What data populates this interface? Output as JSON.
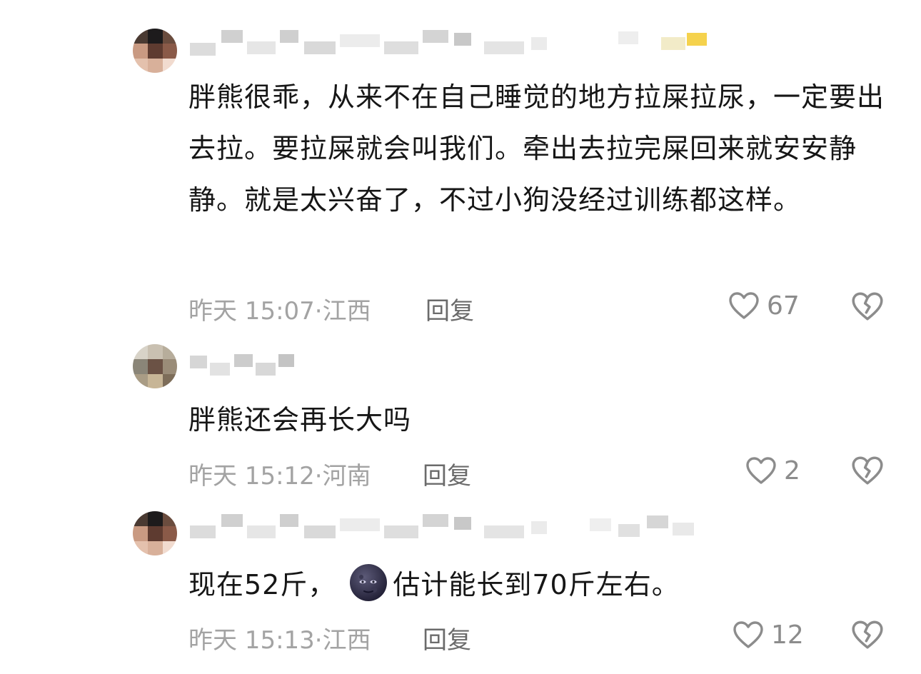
{
  "comments": [
    {
      "text": "胖熊很乖，从来不在自己睡觉的地方拉屎拉尿，一定要出去拉。要拉屎就会叫我们。牵出去拉完屎回来就安安静静。就是太兴奋了，不过小狗没经过训练都这样。",
      "time": "昨天 15:07",
      "location": "江西",
      "reply_label": "回复",
      "likes": "67"
    },
    {
      "text": "胖熊还会再长大吗",
      "time": "昨天 15:12",
      "location": "河南",
      "reply_label": "回复",
      "likes": "2"
    },
    {
      "text_before": "现在52斤，",
      "emoji": "new-moon-face",
      "text_after": "估计能长到70斤左右。",
      "time": "昨天 15:13",
      "location": "江西",
      "reply_label": "回复",
      "likes": "12"
    }
  ],
  "meta_separator": "·",
  "icons": {
    "like": "heart-outline-icon",
    "dislike": "broken-heart-icon"
  },
  "colors": {
    "text": "#161616",
    "meta": "#a3a3a3",
    "reply": "#6b6b6b",
    "icon": "#8c8c8c"
  }
}
